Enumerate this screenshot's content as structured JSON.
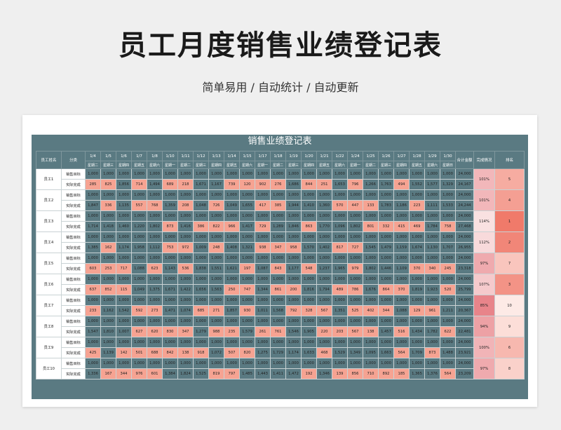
{
  "page": {
    "title": "员工月度销售业绩登记表",
    "subtitle": "简单易用 / 自动统计 / 自动更新"
  },
  "sheet": {
    "title": "销售业绩登记表",
    "headers": {
      "employee": "员工姓名",
      "category": "分类",
      "total": "合计金额",
      "completion": "完成情况",
      "rank": "排名"
    },
    "dates": [
      "1/4",
      "1/5",
      "1/6",
      "1/7",
      "1/8",
      "1/10",
      "1/11",
      "1/12",
      "1/13",
      "1/14",
      "1/15",
      "1/17",
      "1/18",
      "1/19",
      "1/20",
      "1/21",
      "1/22",
      "1/24",
      "1/25",
      "1/26",
      "1/27",
      "1/28",
      "1/29",
      "1/30"
    ],
    "weekdays": [
      "星期二",
      "星期三",
      "星期四",
      "星期五",
      "星期六",
      "星期一",
      "星期二",
      "星期三",
      "星期四",
      "星期五",
      "星期六",
      "星期一",
      "星期二",
      "星期三",
      "星期四",
      "星期五",
      "星期六",
      "星期一",
      "星期二",
      "星期三",
      "星期四",
      "星期五",
      "星期六",
      "星期日"
    ],
    "target_label": "销售目标",
    "actual_label": "实际完成",
    "employees": [
      {
        "name": "员工1",
        "target": [
          "1,000",
          "1,000",
          "1,000",
          "1,000",
          "1,000",
          "1,000",
          "1,000",
          "1,000",
          "1,000",
          "1,000",
          "1,000",
          "1,000",
          "1,000",
          "1,000",
          "1,000",
          "1,000",
          "1,000",
          "1,000",
          "1,000",
          "1,000",
          "1,000",
          "1,000",
          "1,000",
          "1,000"
        ],
        "target_total": "24,000",
        "actual": [
          "285",
          "825",
          "1,856",
          "714",
          "1,494",
          "689",
          "218",
          "1,671",
          "1,167",
          "739",
          "120",
          "902",
          "276",
          "1,686",
          "844",
          "251",
          "1,653",
          "796",
          "1,266",
          "1,763",
          "494",
          "1,552",
          "1,577",
          "1,329"
        ],
        "actual_total": "24,167",
        "rate": "101%",
        "rank": "5"
      },
      {
        "name": "员工2",
        "target": [
          "1,000",
          "1,000",
          "1,000",
          "1,000",
          "1,000",
          "1,000",
          "1,000",
          "1,000",
          "1,000",
          "1,000",
          "1,000",
          "1,000",
          "1,000",
          "1,000",
          "1,000",
          "1,000",
          "1,000",
          "1,000",
          "1,000",
          "1,000",
          "1,000",
          "1,000",
          "1,000",
          "1,000"
        ],
        "target_total": "24,000",
        "actual": [
          "1,847",
          "336",
          "1,135",
          "557",
          "768",
          "1,359",
          "208",
          "1,048",
          "726",
          "1,049",
          "1,655",
          "417",
          "385",
          "1,944",
          "1,410",
          "1,360",
          "570",
          "447",
          "133",
          "1,783",
          "1,186",
          "223",
          "1,111",
          "1,533"
        ],
        "actual_total": "24,244",
        "rate": "101%",
        "rank": "4"
      },
      {
        "name": "员工3",
        "target": [
          "1,000",
          "1,000",
          "1,000",
          "1,000",
          "1,000",
          "1,000",
          "1,000",
          "1,000",
          "1,000",
          "1,000",
          "1,000",
          "1,000",
          "1,000",
          "1,000",
          "1,000",
          "1,000",
          "1,000",
          "1,000",
          "1,000",
          "1,000",
          "1,000",
          "1,000",
          "1,000",
          "1,000"
        ],
        "target_total": "24,000",
        "actual": [
          "1,714",
          "1,418",
          "1,460",
          "1,220",
          "1,802",
          "873",
          "1,416",
          "386",
          "822",
          "966",
          "1,417",
          "729",
          "1,289",
          "1,846",
          "863",
          "1,770",
          "1,096",
          "1,802",
          "801",
          "332",
          "415",
          "469",
          "1,784",
          "758"
        ],
        "actual_total": "27,468",
        "rate": "114%",
        "rank": "1"
      },
      {
        "name": "员工4",
        "target": [
          "1,000",
          "1,000",
          "1,000",
          "1,000",
          "1,000",
          "1,000",
          "1,000",
          "1,000",
          "1,000",
          "1,000",
          "1,000",
          "1,000",
          "1,000",
          "1,000",
          "1,000",
          "1,000",
          "1,000",
          "1,000",
          "1,000",
          "1,000",
          "1,000",
          "1,000",
          "1,000",
          "1,000"
        ],
        "target_total": "24,000",
        "actual": [
          "1,385",
          "162",
          "1,174",
          "1,958",
          "1,112",
          "753",
          "972",
          "1,009",
          "248",
          "1,408",
          "1,321",
          "938",
          "347",
          "958",
          "1,570",
          "1,402",
          "817",
          "727",
          "1,545",
          "1,479",
          "1,159",
          "1,674",
          "1,130",
          "1,707"
        ],
        "actual_total": "26,955",
        "rate": "112%",
        "rank": "2"
      },
      {
        "name": "员工5",
        "target": [
          "1,000",
          "1,000",
          "1,000",
          "1,000",
          "1,000",
          "1,000",
          "1,000",
          "1,000",
          "1,000",
          "1,000",
          "1,000",
          "1,000",
          "1,000",
          "1,000",
          "1,000",
          "1,000",
          "1,000",
          "1,000",
          "1,000",
          "1,000",
          "1,000",
          "1,000",
          "1,000",
          "1,000"
        ],
        "target_total": "24,000",
        "actual": [
          "603",
          "253",
          "717",
          "1,088",
          "623",
          "1,143",
          "536",
          "1,838",
          "1,551",
          "1,621",
          "197",
          "1,087",
          "843",
          "1,177",
          "548",
          "1,237",
          "1,965",
          "979",
          "1,802",
          "1,446",
          "1,109",
          "370",
          "340",
          "245"
        ],
        "actual_total": "23,318",
        "rate": "97%",
        "rank": "7"
      },
      {
        "name": "员工6",
        "target": [
          "1,000",
          "1,000",
          "1,000",
          "1,000",
          "1,000",
          "1,000",
          "1,000",
          "1,000",
          "1,000",
          "1,000",
          "1,000",
          "1,000",
          "1,000",
          "1,000",
          "1,000",
          "1,000",
          "1,000",
          "1,000",
          "1,000",
          "1,000",
          "1,000",
          "1,000",
          "1,000",
          "1,000"
        ],
        "target_total": "24,000",
        "actual": [
          "637",
          "852",
          "115",
          "1,049",
          "1,375",
          "1,671",
          "1,422",
          "1,656",
          "1,563",
          "250",
          "747",
          "1,344",
          "861",
          "200",
          "1,816",
          "1,794",
          "489",
          "786",
          "1,676",
          "864",
          "370",
          "1,819",
          "1,923",
          "520"
        ],
        "actual_total": "25,799",
        "rate": "107%",
        "rank": "3"
      },
      {
        "name": "员工7",
        "target": [
          "1,000",
          "1,000",
          "1,000",
          "1,000",
          "1,000",
          "1,000",
          "1,000",
          "1,000",
          "1,000",
          "1,000",
          "1,000",
          "1,000",
          "1,000",
          "1,000",
          "1,000",
          "1,000",
          "1,000",
          "1,000",
          "1,000",
          "1,000",
          "1,000",
          "1,000",
          "1,000",
          "1,000"
        ],
        "target_total": "24,000",
        "actual": [
          "233",
          "1,162",
          "1,542",
          "592",
          "273",
          "1,471",
          "1,074",
          "685",
          "271",
          "1,857",
          "930",
          "1,011",
          "1,568",
          "792",
          "328",
          "567",
          "1,351",
          "525",
          "402",
          "344",
          "1,088",
          "129",
          "961",
          "1,211"
        ],
        "actual_total": "20,367",
        "rate": "85%",
        "rank": "10"
      },
      {
        "name": "员工8",
        "target": [
          "1,000",
          "1,000",
          "1,000",
          "1,000",
          "1,000",
          "1,000",
          "1,000",
          "1,000",
          "1,000",
          "1,000",
          "1,000",
          "1,000",
          "1,000",
          "1,000",
          "1,000",
          "1,000",
          "1,000",
          "1,000",
          "1,000",
          "1,000",
          "1,000",
          "1,000",
          "1,000",
          "1,000"
        ],
        "target_total": "24,000",
        "actual": [
          "1,547",
          "1,810",
          "1,007",
          "627",
          "620",
          "830",
          "347",
          "1,279",
          "988",
          "235",
          "1,579",
          "261",
          "761",
          "1,546",
          "1,905",
          "220",
          "203",
          "567",
          "138",
          "1,457",
          "516",
          "1,434",
          "1,782",
          "622"
        ],
        "actual_total": "22,481",
        "rate": "94%",
        "rank": "9"
      },
      {
        "name": "员工9",
        "target": [
          "1,000",
          "1,000",
          "1,000",
          "1,000",
          "1,000",
          "1,000",
          "1,000",
          "1,000",
          "1,000",
          "1,000",
          "1,000",
          "1,000",
          "1,000",
          "1,000",
          "1,000",
          "1,000",
          "1,000",
          "1,000",
          "1,000",
          "1,000",
          "1,000",
          "1,000",
          "1,000",
          "1,000"
        ],
        "target_total": "24,000",
        "actual": [
          "425",
          "1,139",
          "142",
          "501",
          "688",
          "842",
          "138",
          "918",
          "1,072",
          "507",
          "820",
          "1,275",
          "1,729",
          "1,174",
          "1,633",
          "468",
          "1,529",
          "1,349",
          "1,095",
          "1,663",
          "564",
          "1,709",
          "873",
          "1,488"
        ],
        "actual_total": "23,921",
        "rate": "100%",
        "rank": "6"
      },
      {
        "name": "员工10",
        "target": [
          "1,000",
          "1,000",
          "1,000",
          "1,000",
          "1,000",
          "1,000",
          "1,000",
          "1,000",
          "1,000",
          "1,000",
          "1,000",
          "1,000",
          "1,000",
          "1,000",
          "1,000",
          "1,000",
          "1,000",
          "1,000",
          "1,000",
          "1,000",
          "1,000",
          "1,000",
          "1,000",
          "1,000"
        ],
        "target_total": "24,000",
        "actual": [
          "1,336",
          "167",
          "344",
          "976",
          "601",
          "1,384",
          "1,824",
          "1,525",
          "819",
          "797",
          "1,485",
          "1,443",
          "1,411",
          "1,472",
          "192",
          "1,346",
          "139",
          "856",
          "710",
          "892",
          "185",
          "1,365",
          "1,376",
          "564"
        ],
        "actual_total": "23,209",
        "rate": "97%",
        "rank": "8"
      }
    ]
  },
  "colors": {
    "header_bg": "#5a7a82",
    "highlight": "#f6a392",
    "rate_bg": "#f2c4c4",
    "rank_top": "#f07a6a",
    "rank_low": "#fdeae6"
  }
}
